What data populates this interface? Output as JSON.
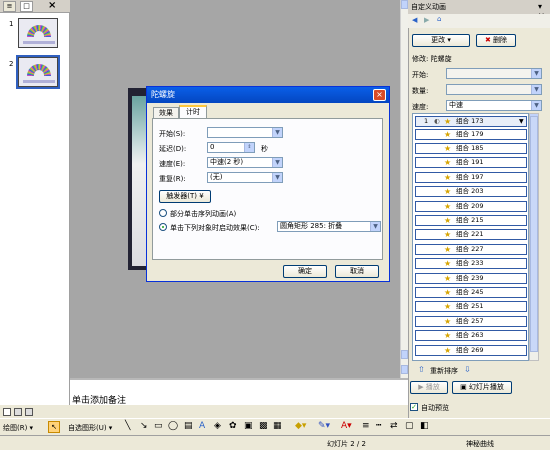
{
  "thumbnails": [
    {
      "number": "1"
    },
    {
      "number": "2"
    }
  ],
  "notes": {
    "placeholder": "单击添加备注"
  },
  "dialog": {
    "title": "陀螺旋",
    "tabs": [
      "效果",
      "计时"
    ],
    "fields": {
      "start_label": "开始(S):",
      "delay_label": "延迟(D):",
      "delay_value": "0",
      "delay_unit": "秒",
      "speed_label": "速度(E):",
      "speed_value": "中速(2 秒)",
      "repeat_label": "重复(R):",
      "repeat_value": "(无)"
    },
    "trigger_button": "触发器(T) ¥",
    "radio1": "部分单击序列动画(A)",
    "radio2": "单击下列对象时启动效果(C):",
    "radio2_value": "圆角矩形 285: 折叠",
    "ok": "确定",
    "cancel": "取消"
  },
  "taskpane": {
    "title": "自定义动画",
    "change_button": "更改",
    "delete_button": "删除",
    "modify_label": "修改: 陀螺旋",
    "start_label": "开始:",
    "amount_label": "数量:",
    "speed_label": "速度:",
    "speed_value": "中速",
    "first_item_index": "1",
    "items": [
      "组合 173",
      "组合 179",
      "组合 185",
      "组合 191",
      "组合 197",
      "组合 203",
      "组合 209",
      "组合 215",
      "组合 221",
      "组合 227",
      "组合 233",
      "组合 239",
      "组合 245",
      "组合 251",
      "组合 257",
      "组合 263",
      "组合 269"
    ],
    "reorder_label": "重新排序",
    "play_button": "播放",
    "slideshow_button": "幻灯片播放",
    "autopreview_label": "自动预览"
  },
  "drawbar": {
    "draw_label": "绘图(R) ▾",
    "autoshapes_label": "自选图形(U) ▾"
  },
  "status": {
    "slide_info": "幻灯片 2 / 2",
    "design": "神秘曲线"
  }
}
